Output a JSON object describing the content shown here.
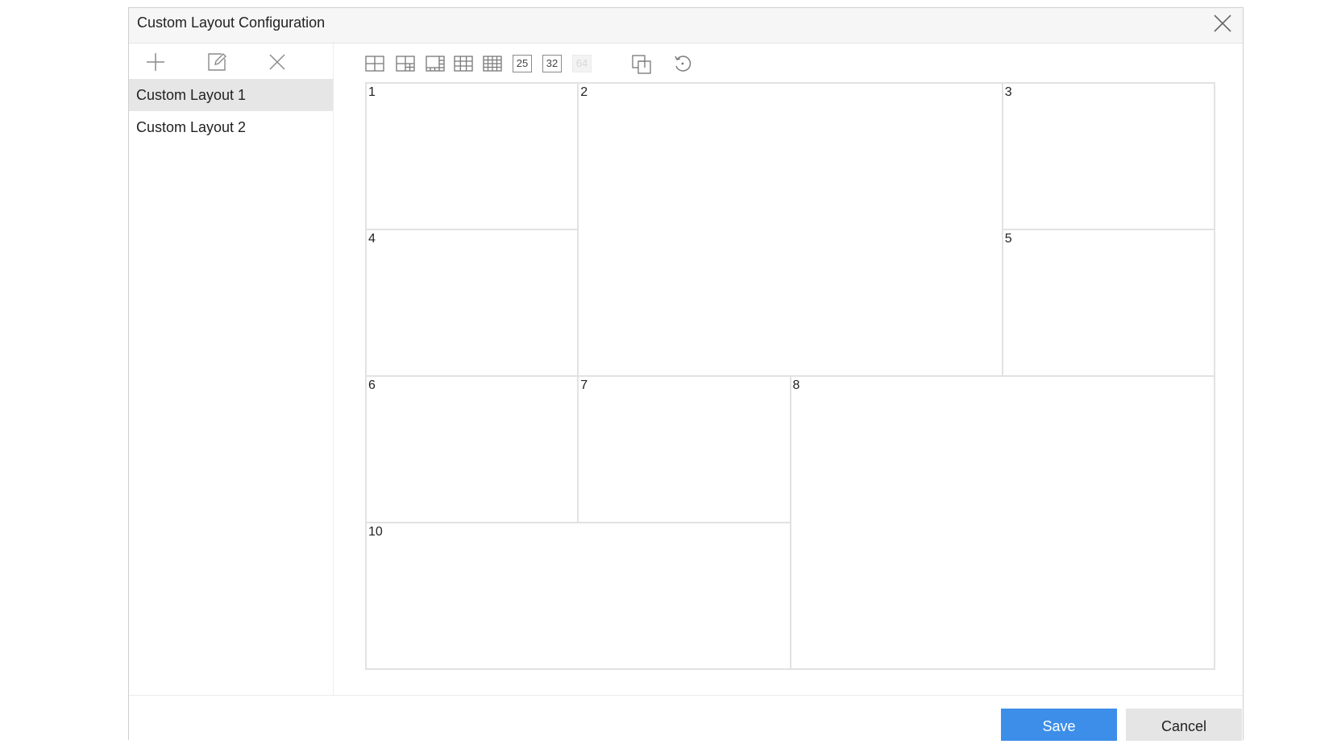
{
  "dialog": {
    "title": "Custom Layout Configuration",
    "close_icon": "close-icon"
  },
  "sidebar": {
    "tools": [
      {
        "name": "add-icon"
      },
      {
        "name": "edit-icon"
      },
      {
        "name": "delete-icon"
      }
    ],
    "items": [
      {
        "label": "Custom Layout 1",
        "selected": true
      },
      {
        "label": "Custom Layout 2",
        "selected": false
      }
    ]
  },
  "toolbar": {
    "layout_presets": [
      "grid-4-icon",
      "grid-6-icon",
      "grid-8-icon",
      "grid-9-icon",
      "grid-16-icon"
    ],
    "num_25": "25",
    "num_32": "32",
    "num_64": "64",
    "num_64_disabled": true,
    "merge_icon": "merge-windows-icon",
    "reset_icon": "restore-icon"
  },
  "grid": {
    "rows": 4,
    "cols": 4,
    "cells": [
      {
        "label": "1"
      },
      {
        "label": "2"
      },
      {
        "label": "3"
      },
      {
        "label": "4"
      },
      {
        "label": "5"
      },
      {
        "label": "6"
      },
      {
        "label": "7"
      },
      {
        "label": "8"
      },
      {
        "label": "10"
      }
    ]
  },
  "footer": {
    "save_label": "Save",
    "cancel_label": "Cancel"
  },
  "colors": {
    "primary": "#3c8ee9",
    "selected_item_bg": "#e6e6e6",
    "border": "#e2e2e2"
  }
}
